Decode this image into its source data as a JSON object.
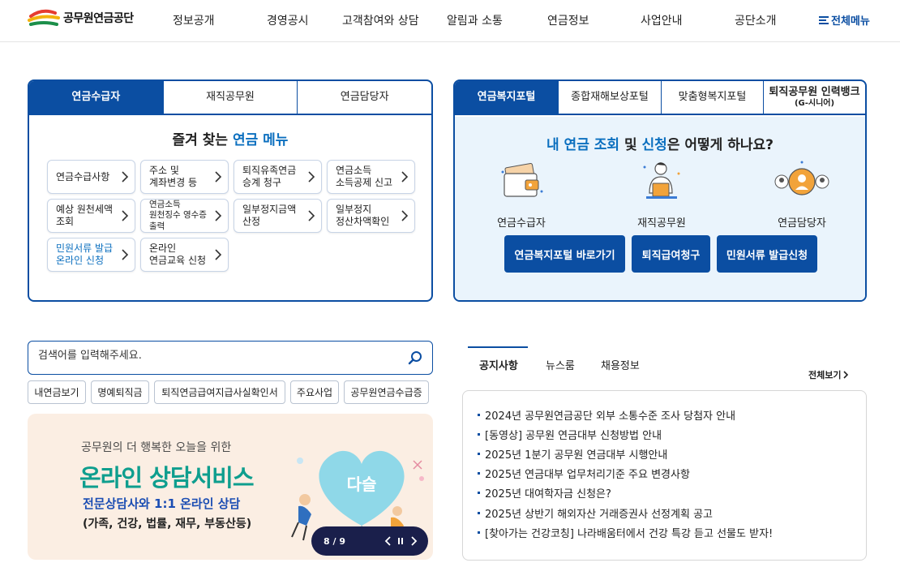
{
  "header": {
    "logo_text": "공무원연금공단",
    "nav": [
      "정보공개",
      "경영공시",
      "고객참여와 상담",
      "알림과 소통",
      "연금정보",
      "사업안내",
      "공단소개"
    ],
    "all_menu": "전체메뉴"
  },
  "left_panel": {
    "tabs": [
      "연금수급자",
      "재직공무원",
      "연금담당자"
    ],
    "active_tab": 0,
    "title_pre": "즐겨 찾는 ",
    "title_hl": "연금 메뉴",
    "menu": [
      {
        "l1": "연금수급사항",
        "l2": ""
      },
      {
        "l1": "주소 및",
        "l2": "계좌변경 등"
      },
      {
        "l1": "퇴직유족연금",
        "l2": "승계 청구"
      },
      {
        "l1": "연금소득",
        "l2": "소득공제 신고"
      },
      {
        "l1": "예상 원천세액",
        "l2": "조회"
      },
      {
        "l1": "연금소득",
        "l2": "원천징수 영수증",
        "l3": "출력"
      },
      {
        "l1": "일부정지금액",
        "l2": "산정"
      },
      {
        "l1": "일부정지",
        "l2": "정산차액확인"
      },
      {
        "l1": "민원서류 발급",
        "l2": "온라인 신청"
      },
      {
        "l1": "온라인",
        "l2": "연금교육 신청"
      }
    ]
  },
  "right_panel": {
    "tabs": [
      "연금복지포털",
      "종합재해보상포털",
      "맞춤형복지포털",
      "퇴직공무원 인력뱅크"
    ],
    "tab4_sub": "(G-시니어)",
    "title": [
      "내 연금 조회",
      " 및 ",
      "신청",
      "은 어떻게 하나요?"
    ],
    "roles": [
      "연금수급자",
      "재직공무원",
      "연금담당자"
    ],
    "buttons": [
      "연금복지포털 바로가기",
      "퇴직급여청구",
      "민원서류 발급신청"
    ]
  },
  "search": {
    "placeholder": "검색어를 입력해주세요.",
    "quick_links": [
      "내연금보기",
      "명예퇴직금",
      "퇴직연금급여지급사실확인서",
      "주요사업",
      "공무원연금수급증"
    ]
  },
  "banner": {
    "sub": "공무원의 더 행복한 오늘을 위한",
    "title": "온라인 상담서비스",
    "line1": "전문상담사와 1:1 온라인 상담",
    "line2": "(가족, 건강, 법률, 재무, 부동산등)",
    "heart": "다슬",
    "pager": "8 / 9"
  },
  "notice": {
    "tabs": [
      "공지사항",
      "뉴스룸",
      "채용정보"
    ],
    "more": "전체보기",
    "items": [
      "2024년 공무원연금공단 외부 소통수준 조사 당첨자 안내",
      "[동영상] 공무원 연금대부 신청방법 안내",
      "2025년 1분기 공무원 연금대부 시행안내",
      "2025년 연금대부 업무처리기준 주요 변경사항",
      "2025년 대여학자금 신청은?",
      "2025년 상반기 해외자산 거래증권사 선정계획 공고",
      "[찾아가는 건강코칭] 나라배움터에서 건강 특강 듣고 선물도 받자!"
    ]
  },
  "colors": {
    "primary": "#0b4ea2",
    "accent": "#0b6fbf",
    "banner_bg": "#fbeee3",
    "banner_title": "#0e9e8e",
    "portal_bg": "#eaf4fc"
  }
}
